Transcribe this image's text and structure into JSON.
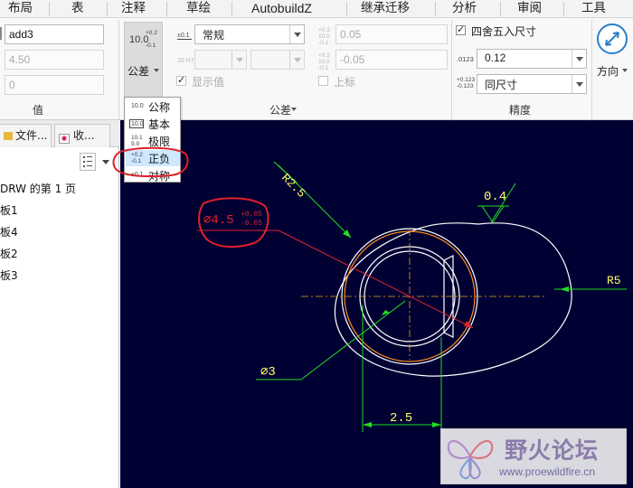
{
  "menu": [
    "布局",
    "表",
    "注释",
    "草绘",
    "AutobuildZ",
    "继承迁移",
    "分析",
    "审阅",
    "工具"
  ],
  "value_group": {
    "label": "值",
    "name_value": "add3",
    "nominal_value": "4.50",
    "decimal_value": "0"
  },
  "tolerance_group": {
    "label": "公差",
    "button_label": "公差",
    "button_icon_top": "+0.2",
    "button_icon_main": "10.0",
    "button_icon_bottom": "-0.1",
    "fit_icon_top": "±0.1",
    "fit_select": "常规",
    "hole_icon": "10 H7",
    "show_value_label": "显示值",
    "upper_value": "0.05",
    "lower_value": "-0.05",
    "upper_label": "上标",
    "upper_icon_top": "+0.2",
    "upper_icon_mid": "10.0",
    "upper_icon_bottom": "-0.1",
    "lower_icon_top": "+0.2",
    "lower_icon_mid": "10.0",
    "lower_icon_bottom": "-0.1"
  },
  "precision_group": {
    "label": "精度",
    "round_label": "四舍五入尺寸",
    "round_checked": true,
    "decimals_icon": ".0123",
    "decimals_value": "0.12",
    "tol_decimals_icon_top": "+0.123",
    "tol_decimals_icon_bottom": "-0.123",
    "tol_decimals_value": "同尺寸"
  },
  "direction": {
    "label": "方向"
  },
  "tolerance_menu": {
    "items": [
      {
        "label": "公称",
        "icon_main": "10.0",
        "selected": false
      },
      {
        "label": "基本",
        "icon_main": "10.0",
        "selected": false
      },
      {
        "label": "极限",
        "icon_top": "10.1",
        "icon_bottom": "9.9",
        "selected": false
      },
      {
        "label": "正负",
        "icon_top": "+0.2",
        "icon_bottom": "-0.1",
        "selected": true
      },
      {
        "label": "对称",
        "icon_main": "±0.1",
        "selected": false
      }
    ]
  },
  "left_panel": {
    "tabs": [
      "文件...",
      "收..."
    ],
    "tree": [
      "DRW 的第 1 页",
      "板1",
      "板4",
      "板2",
      "板3"
    ]
  },
  "drawing": {
    "dim_r25": "R2.5",
    "dim_04": "0.4",
    "dim_r5": "R5",
    "dim_phi45": "∅4.5",
    "dim_phi45_upper": "+0.05",
    "dim_phi45_lower": "-0.05",
    "dim_phi3": "∅3",
    "dim_25": "2.5"
  },
  "watermark": {
    "title": "野火论坛",
    "url": "www.proewildfire.cn"
  },
  "colors": {
    "canvas_bg": "#000033",
    "annotation_red": "#e0202a",
    "dim_green": "#22dd22",
    "dim_yellow": "#ffff66",
    "highlight": "#cde8ff"
  }
}
